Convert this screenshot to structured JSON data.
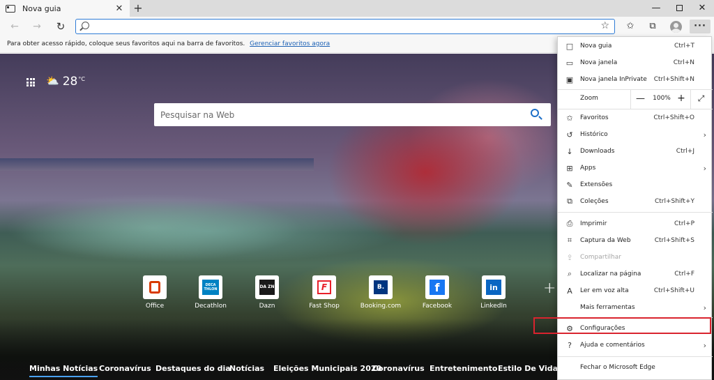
{
  "tab": {
    "title": "Nova guia",
    "close": "✕",
    "icon": "tab-page-icon"
  },
  "new_tab": "+",
  "window_controls": {
    "minimize": "—",
    "close": "✕"
  },
  "nav": {
    "back": "←",
    "forward": "→",
    "refresh": "↻"
  },
  "address": {
    "value": "",
    "placeholder": "",
    "favorite_icon": "☆"
  },
  "toolbar_icons": {
    "favorites": "✩",
    "collections": "⧉",
    "more": "···"
  },
  "favbar": {
    "text": "Para obter acesso rápido, coloque seus favoritos aqui na barra de favoritos.",
    "link": "Gerenciar favoritos agora"
  },
  "weather": {
    "icon": "⛅",
    "temp": "28",
    "unit": "°C"
  },
  "websearch": {
    "placeholder": "Pesquisar na Web"
  },
  "quick_links": [
    {
      "label": "Office",
      "logo_text": "",
      "color": "#d83b01"
    },
    {
      "label": "Decathlon",
      "logo_text": "DECA THLON",
      "color": "#0082c3"
    },
    {
      "label": "Dazn",
      "logo_text": "DA ZN",
      "color": "#1a1a1a"
    },
    {
      "label": "Fast Shop",
      "logo_text": "F",
      "color": "#e8202a"
    },
    {
      "label": "Booking.com",
      "logo_text": "B.",
      "color": "#003580"
    },
    {
      "label": "Facebook",
      "logo_text": "f",
      "color": "#1877f2"
    },
    {
      "label": "LinkedIn",
      "logo_text": "in",
      "color": "#0a66c2"
    }
  ],
  "add_site": "+",
  "news_tabs": [
    "Minhas Notícias",
    "Coronavírus",
    "Destaques do dia",
    "Notícias",
    "Eleições Municipais 2020",
    "Coronavírus",
    "Entretenimento",
    "Estilo De Vida"
  ],
  "menu": {
    "items_top": [
      {
        "label": "Nova guia",
        "shortcut": "Ctrl+T",
        "icon": "□"
      },
      {
        "label": "Nova janela",
        "shortcut": "Ctrl+N",
        "icon": "▭"
      },
      {
        "label": "Nova janela InPrivate",
        "shortcut": "Ctrl+Shift+N",
        "icon": "▣"
      }
    ],
    "zoom": {
      "label": "Zoom",
      "minus": "—",
      "value": "100%",
      "plus": "+",
      "fullscreen": "⤢"
    },
    "items_mid": [
      {
        "label": "Favoritos",
        "shortcut": "Ctrl+Shift+O",
        "icon": "✩",
        "arrow": ""
      },
      {
        "label": "Histórico",
        "shortcut": "",
        "icon": "↺",
        "arrow": "›"
      },
      {
        "label": "Downloads",
        "shortcut": "Ctrl+J",
        "icon": "↓",
        "arrow": ""
      },
      {
        "label": "Apps",
        "shortcut": "",
        "icon": "⊞",
        "arrow": "›"
      },
      {
        "label": "Extensões",
        "shortcut": "",
        "icon": "✎",
        "arrow": ""
      },
      {
        "label": "Coleções",
        "shortcut": "Ctrl+Shift+Y",
        "icon": "⧉",
        "arrow": ""
      }
    ],
    "items_tools": [
      {
        "label": "Imprimir",
        "shortcut": "Ctrl+P",
        "icon": "⎙",
        "arrow": ""
      },
      {
        "label": "Captura da Web",
        "shortcut": "Ctrl+Shift+S",
        "icon": "⌗",
        "arrow": ""
      },
      {
        "label": "Compartilhar",
        "shortcut": "",
        "icon": "⇪",
        "arrow": ""
      },
      {
        "label": "Localizar na página",
        "shortcut": "Ctrl+F",
        "icon": "⌕",
        "arrow": ""
      },
      {
        "label": "Ler em voz alta",
        "shortcut": "Ctrl+Shift+U",
        "icon": "A",
        "arrow": ""
      },
      {
        "label": "Mais ferramentas",
        "shortcut": "",
        "icon": "",
        "arrow": "›"
      }
    ],
    "items_bottom": [
      {
        "label": "Configurações",
        "shortcut": "",
        "icon": "⚙",
        "arrow": ""
      },
      {
        "label": "Ajuda e comentários",
        "shortcut": "",
        "icon": "?",
        "arrow": "›"
      }
    ],
    "close": {
      "label": "Fechar o Microsoft Edge"
    }
  },
  "colors": {
    "accent": "#2e7bd6",
    "highlight": "#d9232e"
  }
}
